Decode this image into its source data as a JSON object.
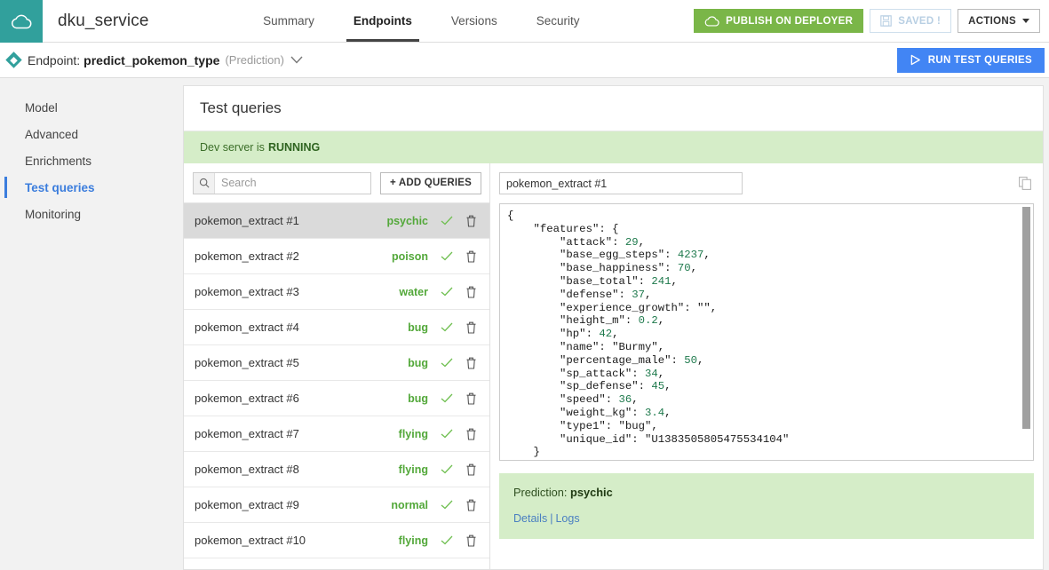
{
  "topbar": {
    "logo_icon": "cloud-icon",
    "app_title": "dku_service",
    "nav": [
      {
        "label": "Summary",
        "active": false
      },
      {
        "label": "Endpoints",
        "active": true
      },
      {
        "label": "Versions",
        "active": false
      },
      {
        "label": "Security",
        "active": false
      }
    ],
    "publish_label": "PUBLISH ON DEPLOYER",
    "publish_icon": "cloud-upload-icon",
    "saved_label": "SAVED !",
    "saved_icon": "floppy-disk-icon",
    "actions_label": "ACTIONS",
    "actions_icon": "caret-down-icon"
  },
  "endpointbar": {
    "icon": "diamond-icon",
    "prefix": "Endpoint:",
    "name": "predict_pokemon_type",
    "kind": "(Prediction)",
    "chevron": "⌄",
    "run_label": "RUN TEST QUERIES",
    "run_icon": "play-icon"
  },
  "sidebar": {
    "items": [
      {
        "label": "Model",
        "active": false
      },
      {
        "label": "Advanced",
        "active": false
      },
      {
        "label": "Enrichments",
        "active": false
      },
      {
        "label": "Test queries",
        "active": true
      },
      {
        "label": "Monitoring",
        "active": false
      }
    ]
  },
  "main": {
    "card_title": "Test queries",
    "dev_banner_prefix": "Dev server is",
    "dev_banner_status": "RUNNING"
  },
  "query_list": {
    "search_placeholder": "Search",
    "search_value": "",
    "search_icon": "search-icon",
    "add_queries_label": "+ ADD QUERIES",
    "check_icon": "check-icon",
    "trash_icon": "trash-icon",
    "rows": [
      {
        "name": "pokemon_extract #1",
        "type": "psychic",
        "selected": true
      },
      {
        "name": "pokemon_extract #2",
        "type": "poison",
        "selected": false
      },
      {
        "name": "pokemon_extract #3",
        "type": "water",
        "selected": false
      },
      {
        "name": "pokemon_extract #4",
        "type": "bug",
        "selected": false
      },
      {
        "name": "pokemon_extract #5",
        "type": "bug",
        "selected": false
      },
      {
        "name": "pokemon_extract #6",
        "type": "bug",
        "selected": false
      },
      {
        "name": "pokemon_extract #7",
        "type": "flying",
        "selected": false
      },
      {
        "name": "pokemon_extract #8",
        "type": "flying",
        "selected": false
      },
      {
        "name": "pokemon_extract #9",
        "type": "normal",
        "selected": false
      },
      {
        "name": "pokemon_extract #10",
        "type": "flying",
        "selected": false
      }
    ]
  },
  "editor": {
    "name_value": "pokemon_extract #1",
    "copy_icon": "copy-icon",
    "code_lines": [
      "{",
      "    \"features\": {",
      "        \"attack\": 29,",
      "        \"base_egg_steps\": 4237,",
      "        \"base_happiness\": 70,",
      "        \"base_total\": 241,",
      "        \"defense\": 37,",
      "        \"experience_growth\": \"\",",
      "        \"height_m\": 0.2,",
      "        \"hp\": 42,",
      "        \"name\": \"Burmy\",",
      "        \"percentage_male\": 50,",
      "        \"sp_attack\": 34,",
      "        \"sp_defense\": 45,",
      "        \"speed\": 36,",
      "        \"weight_kg\": 3.4,",
      "        \"type1\": \"bug\",",
      "        \"unique_id\": \"U1383505805475534104\"",
      "    }",
      "}"
    ]
  },
  "result": {
    "prediction_prefix": "Prediction:",
    "prediction_value": "psychic",
    "details_label": "Details",
    "separator": "|",
    "logs_label": "Logs"
  },
  "colors": {
    "brand_teal": "#31a09c",
    "publish_green": "#7ab648",
    "run_blue": "#4285f4",
    "accent_blue": "#3b7ddd",
    "banner_green_bg": "#d5edc8",
    "type_green": "#53a83a"
  }
}
